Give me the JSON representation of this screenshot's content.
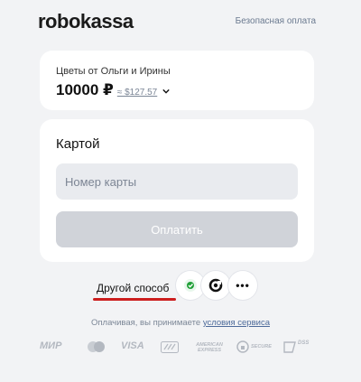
{
  "header": {
    "logo_text": "robokassa",
    "secure_label": "Безопасная оплата"
  },
  "order": {
    "merchant": "Цветы от Ольги и Ирины",
    "amount": "10000 ₽",
    "approx": "≈ $127.57"
  },
  "payment": {
    "title": "Картой",
    "card_placeholder": "Номер карты",
    "pay_label": "Оплатить"
  },
  "other_methods": {
    "label": "Другой способ",
    "more": "•••"
  },
  "terms": {
    "text": "Оплачивая, вы принимаете",
    "link": "условия сервиса"
  },
  "payment_logos": [
    "МИР",
    "VISA",
    "AMERICAN EXPRESS",
    "SECURE",
    "DSS"
  ],
  "colors": {
    "accent_underline": "#cc1e1e",
    "button_disabled": "#d0d3d9",
    "background": "#f2f3f5"
  }
}
